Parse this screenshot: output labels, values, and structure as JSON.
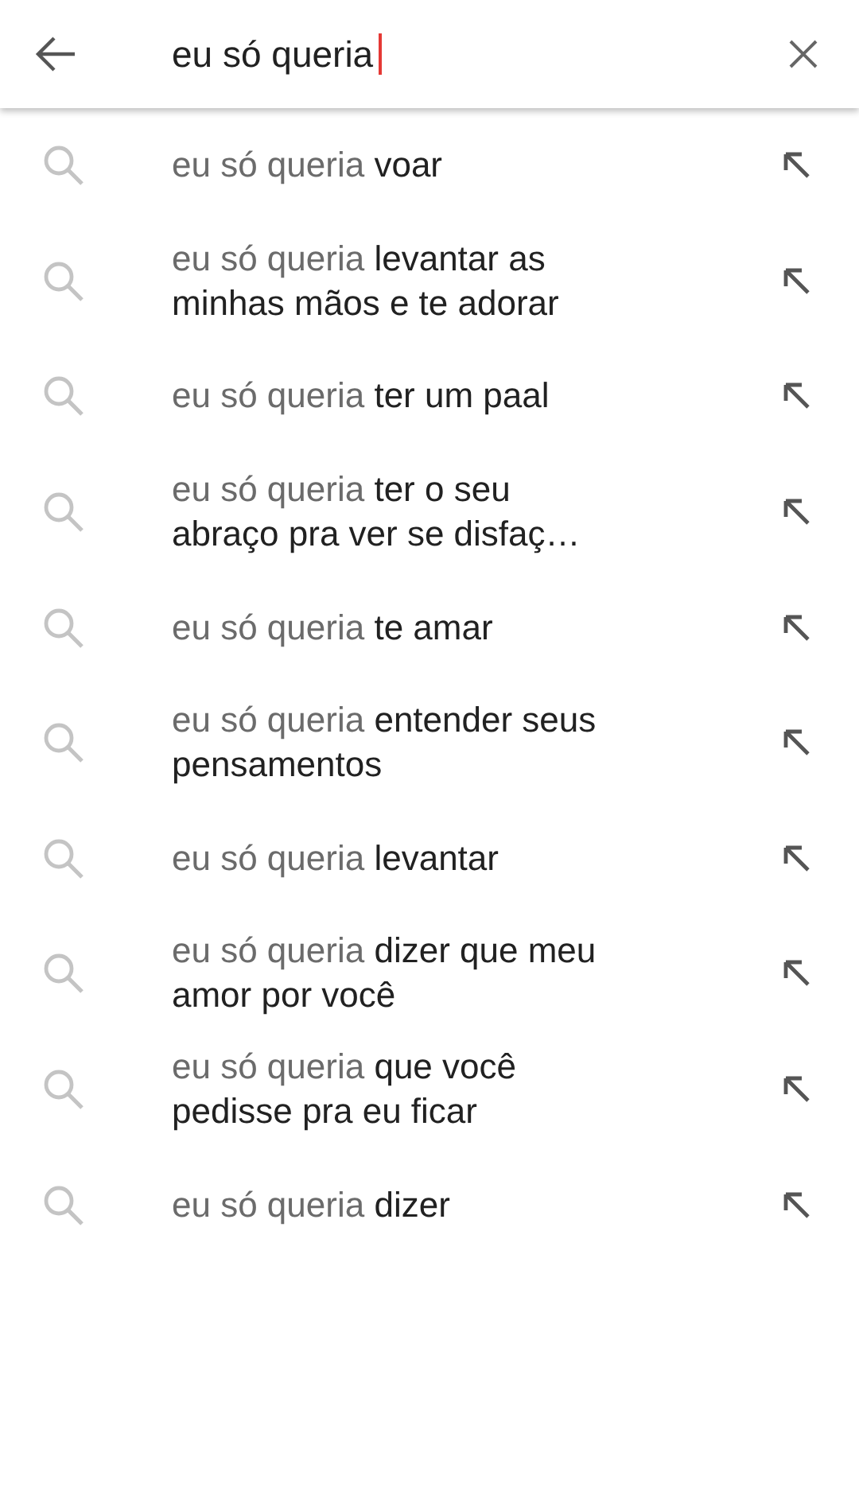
{
  "search": {
    "value": "eu só queria"
  },
  "suggestions": [
    {
      "prefix": "eu só queria",
      "completion": "voar"
    },
    {
      "prefix": "eu só queria",
      "completion": "levantar as minhas mãos e te adorar"
    },
    {
      "prefix": "eu só queria",
      "completion": "ter um paal"
    },
    {
      "prefix": "eu só queria",
      "completion": "ter o seu abraço pra ver se disfaç…"
    },
    {
      "prefix": "eu só queria",
      "completion": "te amar"
    },
    {
      "prefix": "eu só queria",
      "completion": "entender seus pensamentos"
    },
    {
      "prefix": "eu só queria",
      "completion": "levantar"
    },
    {
      "prefix": "eu só queria",
      "completion": "dizer que meu amor por você"
    },
    {
      "prefix": "eu só queria",
      "completion": "que você pedisse pra eu ficar"
    },
    {
      "prefix": "eu só queria",
      "completion": "dizer"
    }
  ]
}
